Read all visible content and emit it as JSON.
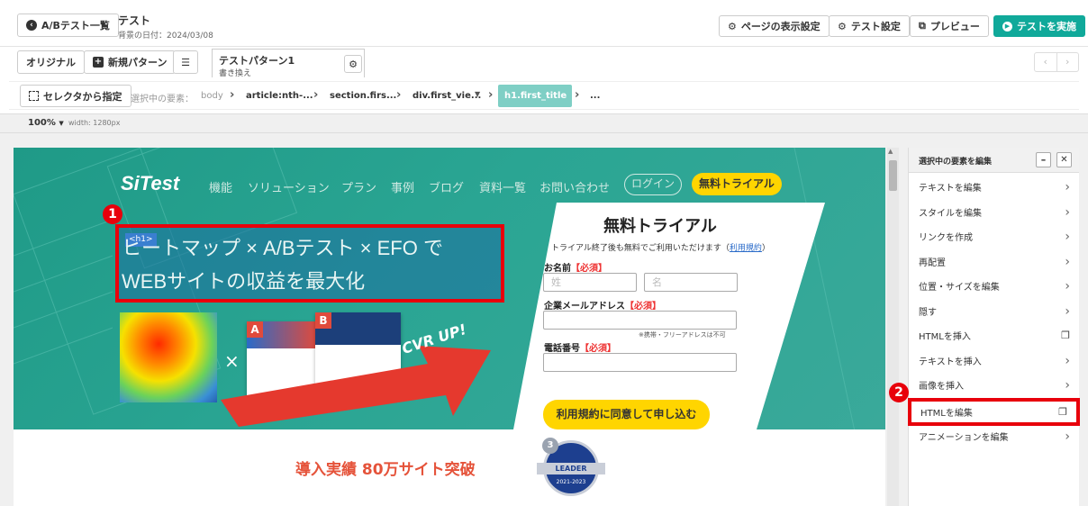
{
  "topbar": {
    "back_button": "A/Bテスト一覧",
    "test_title": "テスト",
    "background_date": "背景の日付：2024/03/08",
    "display_settings": "ページの表示設定",
    "test_settings": "テスト設定",
    "preview": "プレビュー",
    "run_test": "テストを実施"
  },
  "patternbar": {
    "original": "オリジナル",
    "new_pattern": "新規パターン",
    "pattern_name": "テストパターン1",
    "pattern_sub": "書き換え"
  },
  "selectorbar": {
    "select_button": "セレクタから指定",
    "selected_label": "選択中の要素：",
    "crumbs": [
      "body",
      "article:nth-...",
      "section.firs...",
      "div.first_vie...",
      "h1.first_title",
      "..."
    ]
  },
  "zoombar": {
    "zoom": "100%",
    "width": "width: 1280px"
  },
  "site": {
    "logo": "SiTest",
    "nav": [
      "機能",
      "ソリューション",
      "プラン",
      "事例",
      "ブログ",
      "資料一覧",
      "お問い合わせ"
    ],
    "login": "ログイン",
    "trial_nav": "無料トライアル",
    "h1_tag": "<h1>",
    "headline_line1": "ヒートマップ × A/Bテスト × EFO で",
    "headline_line2": "WEBサイトの収益を最大化",
    "cvr": "CVR UP!",
    "label_a": "A",
    "label_b": "B",
    "times": "×",
    "form_title": "無料トライアル",
    "form_subtitle": "トライアル終了後も無料でご利用いただけます（",
    "form_terms": "利用規約",
    "form_subtitle_end": "）",
    "name_label": "お名前",
    "required": "【必須】",
    "surname_ph": "姓",
    "given_ph": "名",
    "email_label": "企業メールアドレス",
    "email_note": "※携帯・フリーアドレスは不可",
    "phone_label": "電話番号",
    "submit": "利用規約に同意して申し込む",
    "achievement": "導入実績 80万サイト突破",
    "badge_text": "LEADER",
    "badge_num": "3",
    "badge_year": "2021-2023"
  },
  "markers": {
    "one": "1",
    "two": "2"
  },
  "panel": {
    "title": "選択中の要素を編集",
    "items": [
      "テキストを編集",
      "スタイルを編集",
      "リンクを作成",
      "再配置",
      "位置・サイズを編集",
      "隠す",
      "HTMLを挿入",
      "テキストを挿入",
      "画像を挿入",
      "HTMLを編集",
      "アニメーションを編集"
    ]
  },
  "colors": {
    "accent": "#10a99a",
    "teal_bg": "#2aa593",
    "highlight": "#e8000b",
    "yellow": "#ffd500"
  }
}
